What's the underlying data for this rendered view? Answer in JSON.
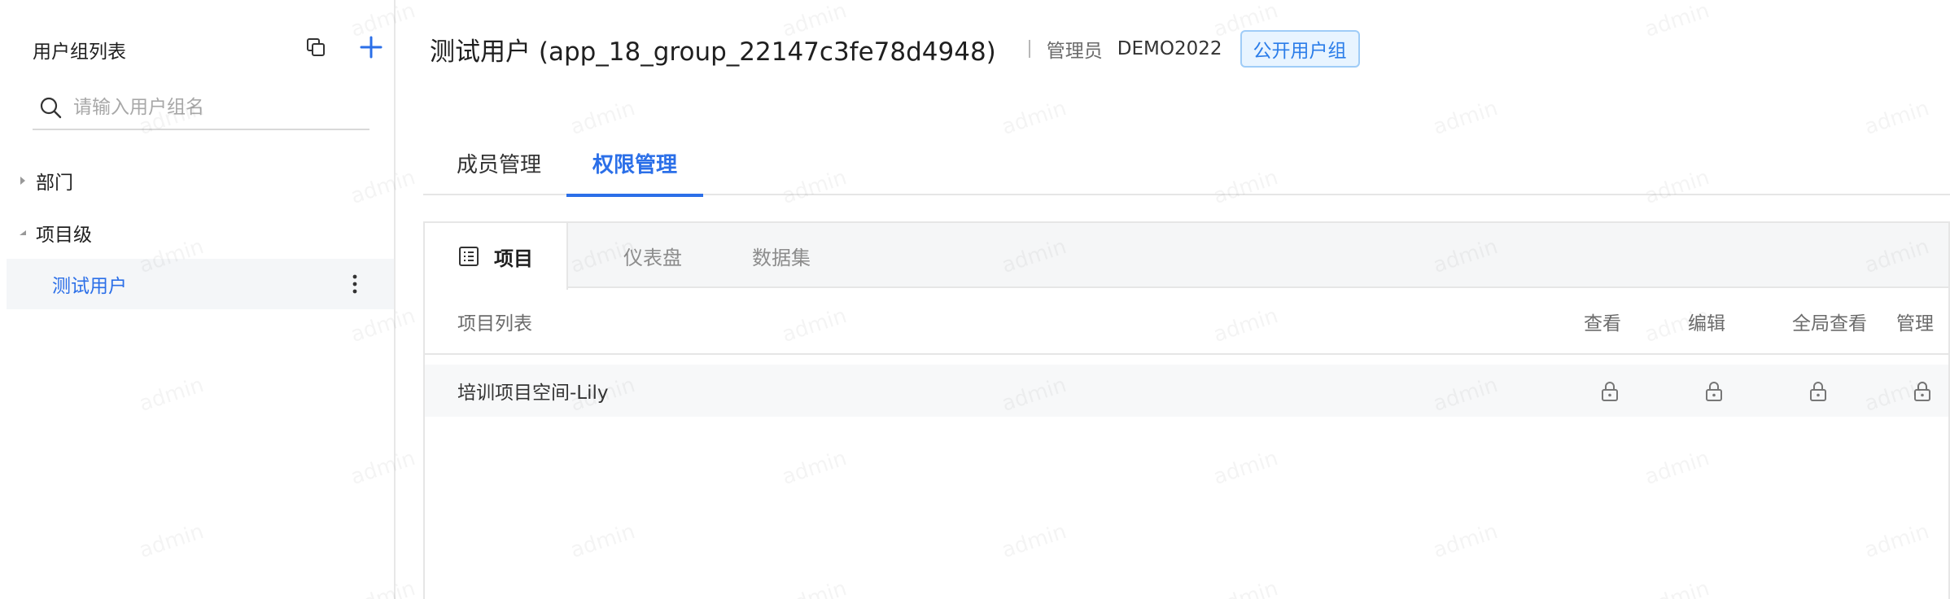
{
  "sidebar": {
    "title": "用户组列表",
    "search": {
      "placeholder": "请输入用户组名",
      "value": ""
    },
    "tree": [
      {
        "label": "部门",
        "expanded": false,
        "children": []
      },
      {
        "label": "项目级",
        "expanded": true,
        "children": [
          {
            "label": "测试用户",
            "selected": true
          }
        ]
      }
    ]
  },
  "header": {
    "title": "测试用户 (app_18_group_22147c3fe78d4948)",
    "admin_label": "管理员",
    "admin_value": "DEMO2022",
    "badge": "公开用户组"
  },
  "tabs": [
    {
      "label": "成员管理",
      "active": false
    },
    {
      "label": "权限管理",
      "active": true
    }
  ],
  "subtabs": [
    {
      "label": "项目",
      "active": true
    },
    {
      "label": "仪表盘",
      "active": false
    },
    {
      "label": "数据集",
      "active": false
    }
  ],
  "table": {
    "columns": [
      "项目列表",
      "查看",
      "编辑",
      "全局查看",
      "管理"
    ],
    "rows": [
      {
        "name": "培训项目空间-Lily",
        "permissions": [
          "locked",
          "locked",
          "locked",
          "locked"
        ]
      }
    ]
  },
  "watermark": "admin",
  "colors": {
    "accent": "#2b6fe8",
    "badge_bg": "#e8f4ff",
    "badge_border": "#9fccf7"
  }
}
